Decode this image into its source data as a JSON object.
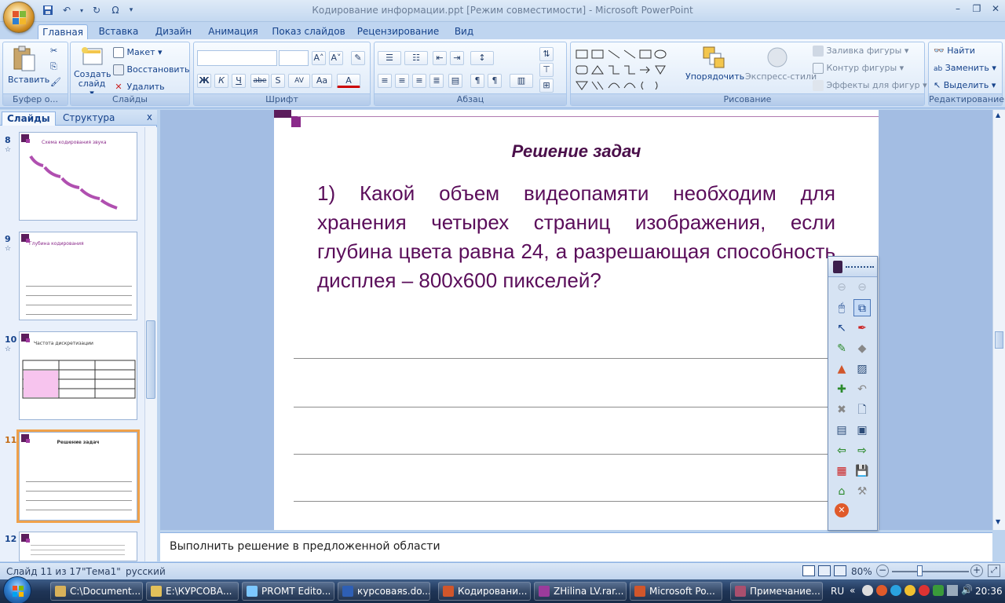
{
  "window": {
    "title": "Кодирование информации.ppt [Режим совместимости] - Microsoft PowerPoint"
  },
  "tabs": [
    {
      "label": "Главная",
      "active": true
    },
    {
      "label": "Вставка"
    },
    {
      "label": "Дизайн"
    },
    {
      "label": "Анимация"
    },
    {
      "label": "Показ слайдов"
    },
    {
      "label": "Рецензирование"
    },
    {
      "label": "Вид"
    }
  ],
  "ribbon": {
    "clipboard": {
      "paste": "Вставить",
      "label": "Буфер о..."
    },
    "slides": {
      "create": "Создать слайд",
      "create_arrow": "▾",
      "layout": "Макет",
      "reset": "Восстановить",
      "delete": "Удалить",
      "label": "Слайды"
    },
    "font": {
      "label": "Шрифт",
      "bold": "Ж",
      "italic": "К",
      "underline": "Ч",
      "strike": "abe",
      "shadow": "S",
      "spacing": "AV",
      "case": "Aa",
      "color": "A"
    },
    "paragraph": {
      "label": "Абзац"
    },
    "drawing": {
      "arrange": "Упорядочить",
      "styles": "Экспресс-стили",
      "fill": "Заливка фигуры",
      "outline": "Контур фигуры",
      "effects": "Эффекты для фигур",
      "label": "Рисование"
    },
    "editing": {
      "find": "Найти",
      "replace": "Заменить",
      "select": "Выделить",
      "label": "Редактирование"
    }
  },
  "left_pane": {
    "tab_slides": "Слайды",
    "tab_outline": "Структура",
    "close": "x",
    "thumbnails": [
      {
        "num": "8",
        "title": "Схема кодирования звука"
      },
      {
        "num": "9",
        "title": "Глубина кодирования"
      },
      {
        "num": "10",
        "title": "Частота дискретизации"
      },
      {
        "num": "11",
        "title": "Решение задач",
        "selected": true
      },
      {
        "num": "12",
        "title": ""
      }
    ]
  },
  "slide": {
    "title": "Решение задач",
    "body": "1) Какой объем видеопамяти необходим для хранения четырех страниц изображения, если глубина цвета равна 24, а разрешающая способность дисплея – 800х600 пикселей?"
  },
  "notes": {
    "text": "Выполнить решение в предложенной области"
  },
  "status": {
    "slide": "Слайд 11 из 17",
    "theme": "\"Тема1\"",
    "lang": "русский",
    "zoom": "80%"
  },
  "taskbar": {
    "items": [
      {
        "label": "C:\\Document...",
        "color": "#d8b15a"
      },
      {
        "label": "E:\\КУРСОВА...",
        "color": "#e2c05a"
      },
      {
        "label": "PROMT Edito...",
        "color": "#7cc7ff"
      },
      {
        "label": "курсоваяs.do...",
        "color": "#2e5fb5"
      },
      {
        "label": "Кодировани...",
        "color": "#d1562b"
      },
      {
        "label": "ZHilina LV.rar...",
        "color": "#9b3b9b"
      },
      {
        "label": "Microsoft Po...",
        "color": "#d1562b"
      },
      {
        "label": "Примечание...",
        "color": "#a94f6e"
      }
    ],
    "lang": "RU",
    "clock": "20:36"
  }
}
